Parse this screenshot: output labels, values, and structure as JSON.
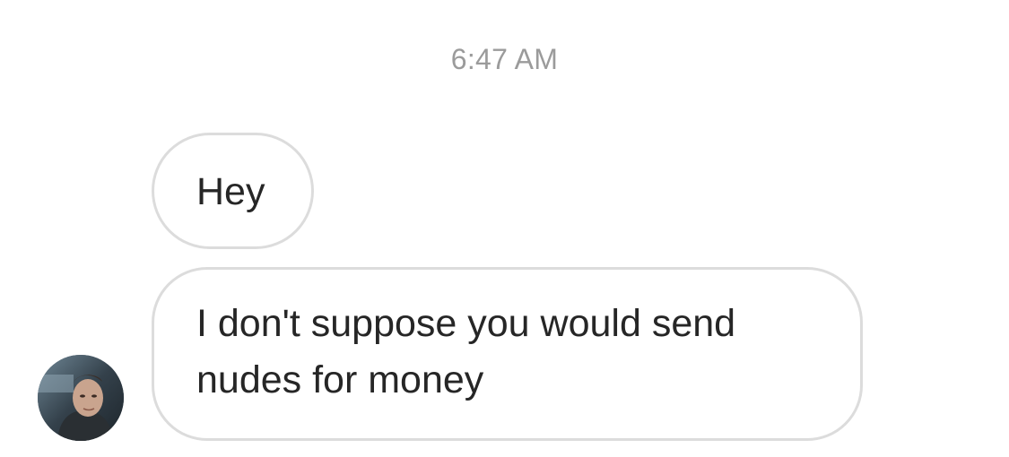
{
  "thread": {
    "timestamp": "6:47 AM",
    "messages": [
      {
        "sender": "other",
        "text": "Hey"
      },
      {
        "sender": "other",
        "text": "I don't suppose you would send nudes for money"
      }
    ]
  },
  "sender_avatar": {
    "icon": "user-avatar-photo"
  },
  "colors": {
    "timestamp": "#9b9b9b",
    "bubble_border": "#dcdcdc",
    "message_text": "#262626",
    "background": "#ffffff"
  }
}
